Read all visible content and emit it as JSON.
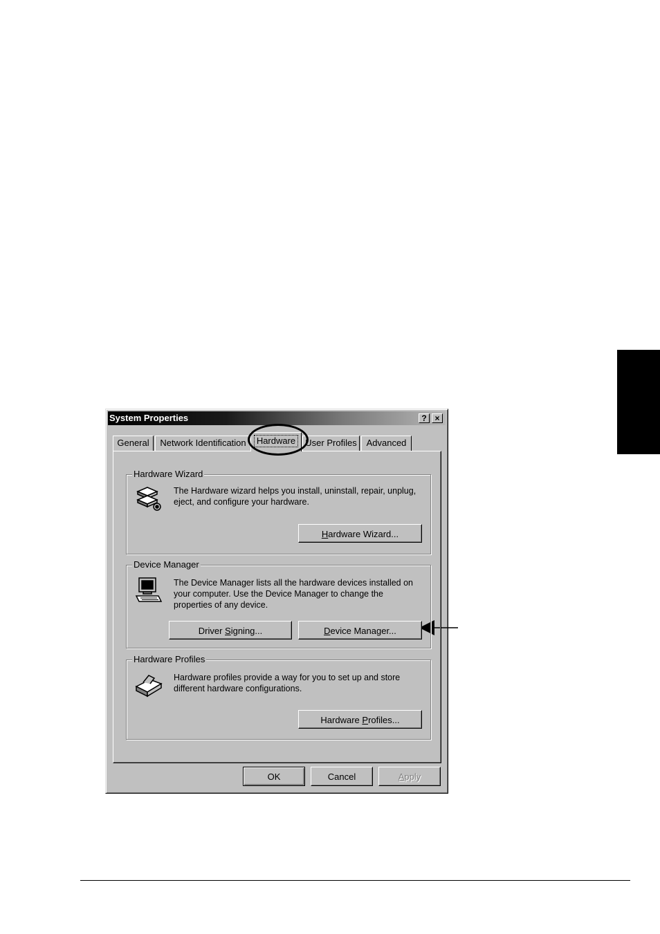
{
  "dialog": {
    "title": "System Properties",
    "help_button": "?",
    "close_button": "×"
  },
  "tabs": [
    {
      "label": "General",
      "active": false
    },
    {
      "label": "Network Identification",
      "active": false
    },
    {
      "label": "Hardware",
      "active": true
    },
    {
      "label": "User Profiles",
      "active": false
    },
    {
      "label": "Advanced",
      "active": false
    }
  ],
  "hardware_wizard": {
    "title": "Hardware Wizard",
    "description": "The Hardware wizard helps you install, uninstall, repair, unplug, eject, and configure your hardware.",
    "button": {
      "prefix": "",
      "mnemonic": "H",
      "suffix": "ardware Wizard..."
    }
  },
  "device_manager": {
    "title": "Device Manager",
    "description": "The Device Manager lists all the hardware devices installed on your computer. Use the Device Manager to change the properties of any device.",
    "driver_signing_button": {
      "prefix": "Driver ",
      "mnemonic": "S",
      "suffix": "igning..."
    },
    "device_manager_button": {
      "prefix": "",
      "mnemonic": "D",
      "suffix": "evice Manager..."
    }
  },
  "hardware_profiles": {
    "title": "Hardware Profiles",
    "description": "Hardware profiles provide a way for you to set up and store different hardware configurations.",
    "button": {
      "prefix": "Hardware ",
      "mnemonic": "P",
      "suffix": "rofiles..."
    }
  },
  "footer": {
    "ok": "OK",
    "cancel": "Cancel",
    "apply": {
      "prefix": "",
      "mnemonic": "A",
      "suffix": "pply"
    }
  },
  "icons": {
    "hardware_wizard": "hardware-wizard-icon",
    "device_manager": "computer-icon",
    "hardware_profiles": "hardware-profiles-icon",
    "callout": "arrow-left-icon"
  }
}
